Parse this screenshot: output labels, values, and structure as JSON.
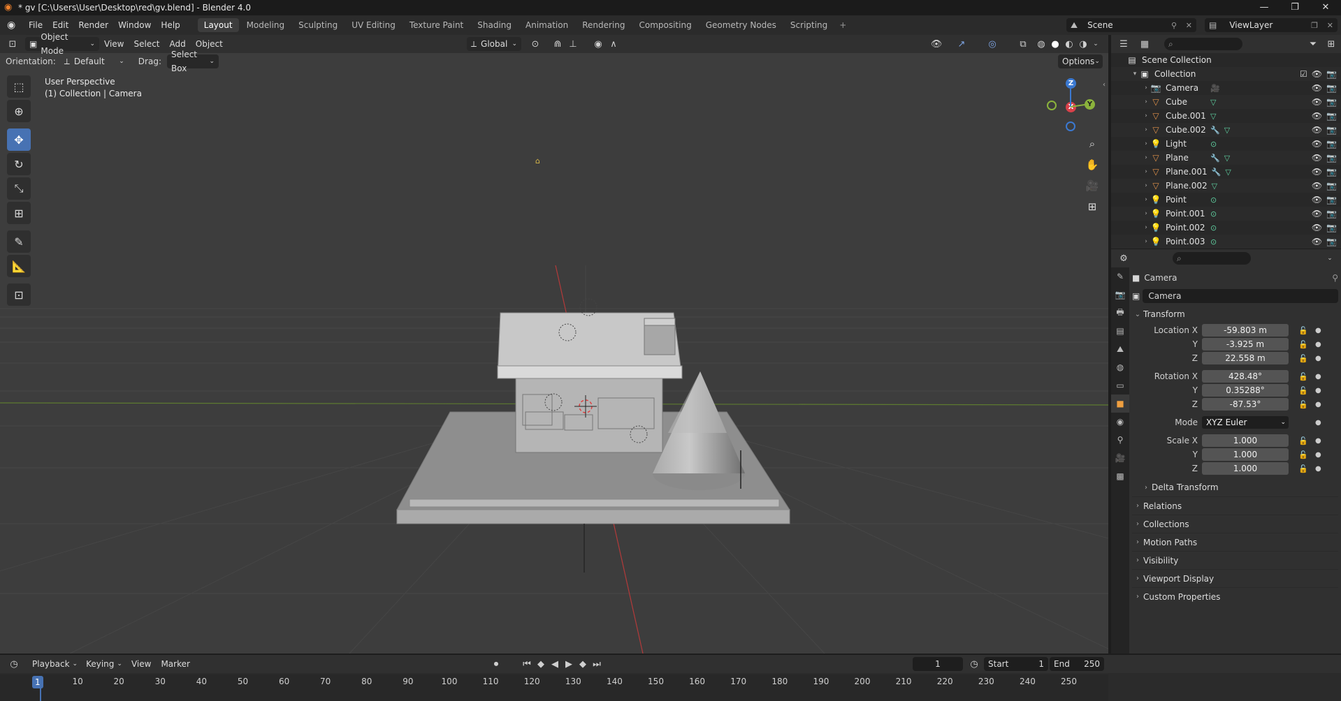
{
  "titlebar": {
    "title": "* gv [C:\\Users\\User\\Desktop\\red\\gv.blend] - Blender 4.0",
    "minimize": "—",
    "maximize": "❐",
    "close": "✕"
  },
  "menu": {
    "items": [
      "File",
      "Edit",
      "Render",
      "Window",
      "Help"
    ]
  },
  "workspaces": {
    "tabs": [
      "Layout",
      "Modeling",
      "Sculpting",
      "UV Editing",
      "Texture Paint",
      "Shading",
      "Animation",
      "Rendering",
      "Compositing",
      "Geometry Nodes",
      "Scripting"
    ],
    "active": "Layout",
    "plus": "+"
  },
  "scene": {
    "label": "Scene",
    "viewlayer": "ViewLayer"
  },
  "viewport_header": {
    "mode": "Object Mode",
    "menus": [
      "View",
      "Select",
      "Add",
      "Object"
    ],
    "transform_orientation": "Global",
    "options": "Options"
  },
  "tool_settings": {
    "orientation_label": "Orientation:",
    "orientation_value": "Default",
    "drag_label": "Drag:",
    "drag_value": "Select Box"
  },
  "viewport": {
    "view_name": "User Perspective",
    "collection_info": "(1) Collection | Camera",
    "gizmo": {
      "z": "Z",
      "x": "X",
      "y": "Y"
    },
    "colors": {
      "x_axis": "#d9414a",
      "y_axis": "#8bb33c",
      "z_axis": "#3b79d1",
      "accent": "#4772b3"
    }
  },
  "outliner": {
    "root": "Scene Collection",
    "collection": "Collection",
    "items": [
      {
        "name": "Camera",
        "type": "camera",
        "data": "camera-data-icon"
      },
      {
        "name": "Cube",
        "type": "mesh",
        "data": "mesh-data-icon"
      },
      {
        "name": "Cube.001",
        "type": "mesh",
        "data": "mesh-data-icon"
      },
      {
        "name": "Cube.002",
        "type": "mesh",
        "data": "modifier-mesh-icons"
      },
      {
        "name": "Light",
        "type": "light",
        "data": "light-data-icon"
      },
      {
        "name": "Plane",
        "type": "mesh",
        "data": "modifier-mesh-icons"
      },
      {
        "name": "Plane.001",
        "type": "mesh",
        "data": "modifier-mesh-icons"
      },
      {
        "name": "Plane.002",
        "type": "mesh",
        "data": "mesh-data-icon"
      },
      {
        "name": "Point",
        "type": "light",
        "data": "light-data-icon"
      },
      {
        "name": "Point.001",
        "type": "light",
        "data": "light-data-icon"
      },
      {
        "name": "Point.002",
        "type": "light",
        "data": "light-data-icon"
      },
      {
        "name": "Point.003",
        "type": "light",
        "data": "light-data-icon"
      }
    ]
  },
  "properties": {
    "context": "Camera",
    "object_name": "Camera",
    "transform": {
      "title": "Transform",
      "location_label": "Location X",
      "location": [
        "-59.803 m",
        "-3.925 m",
        "22.558 m"
      ],
      "rotation_label": "Rotation X",
      "rotation": [
        "428.48°",
        "0.35288°",
        "-87.53°"
      ],
      "mode_label": "Mode",
      "mode": "XYZ Euler",
      "scale_label": "Scale X",
      "scale": [
        "1.000",
        "1.000",
        "1.000"
      ],
      "y": "Y",
      "z": "Z",
      "delta": "Delta Transform"
    },
    "panels": [
      "Relations",
      "Collections",
      "Motion Paths",
      "Visibility",
      "Viewport Display",
      "Custom Properties"
    ]
  },
  "timeline": {
    "menus": [
      "Playback",
      "Keying",
      "View",
      "Marker"
    ],
    "current_frame": "1",
    "start_label": "Start",
    "start": "1",
    "end_label": "End",
    "end": "250",
    "ruler": [
      "10",
      "20",
      "30",
      "40",
      "50",
      "60",
      "70",
      "80",
      "90",
      "100",
      "110",
      "120",
      "130",
      "140",
      "150",
      "160",
      "170",
      "180",
      "190",
      "200",
      "210",
      "220",
      "230",
      "240",
      "250"
    ],
    "ruler_current": "1"
  }
}
